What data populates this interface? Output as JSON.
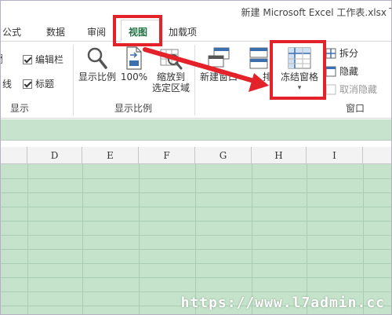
{
  "window": {
    "title": "新建 Microsoft Excel 工作表.xlsx",
    "title_suffix": "-"
  },
  "tabs": [
    {
      "label": "公式"
    },
    {
      "label": "数据"
    },
    {
      "label": "审阅"
    },
    {
      "label": "视图",
      "active": true
    },
    {
      "label": "加载项"
    }
  ],
  "ribbon": {
    "show_group": {
      "label": "显示",
      "items": [
        {
          "label": "编辑栏",
          "checked": true
        },
        {
          "label": "标题",
          "checked": true
        },
        {
          "label": "线",
          "partial": true
        }
      ]
    },
    "zoom_group": {
      "label": "显示比例",
      "buttons": [
        {
          "label": "显示比例",
          "icon": "magnifier-icon"
        },
        {
          "label": "100%",
          "icon": "zoom-100-icon"
        },
        {
          "label": "缩放到",
          "label2": "选定区域",
          "icon": "zoom-selection-icon"
        }
      ]
    },
    "window_group": {
      "label": "窗口",
      "buttons": [
        {
          "label": "新建窗口",
          "icon": "new-window-icon"
        },
        {
          "label": "全部重排",
          "partial": "排",
          "icon": "arrange-all-icon"
        },
        {
          "label": "冻结窗格",
          "icon": "freeze-panes-icon",
          "dropdown": "▾"
        }
      ],
      "small_buttons": [
        {
          "label": "拆分",
          "enabled": true
        },
        {
          "label": "隐藏",
          "enabled": true
        },
        {
          "label": "取消隐藏",
          "enabled": false
        }
      ]
    }
  },
  "grid": {
    "columns": [
      "D",
      "E",
      "F",
      "G",
      "H",
      "I"
    ],
    "colors": {
      "sheet": "#c5e3ca",
      "strip": "#c7e3cd",
      "accent": "#217346",
      "highlight": "#e3222a"
    }
  },
  "watermark": "https://www.l7admin.cc"
}
